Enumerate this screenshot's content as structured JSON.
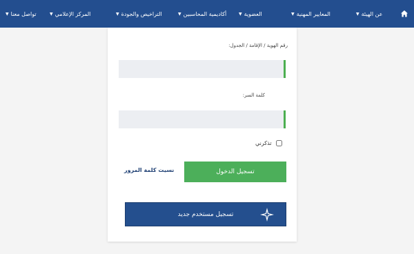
{
  "nav": {
    "items": [
      {
        "label": "عن الهيئة"
      },
      {
        "label": "المعايير المهنية"
      },
      {
        "label": "العضوية"
      },
      {
        "label": "أكاديمية المحاسبين"
      },
      {
        "label": "التراخيص والجودة"
      },
      {
        "label": "المركز الإعلامي"
      },
      {
        "label": "تواصل معنا"
      }
    ],
    "home_icon": "home-icon",
    "caret_icon": "chevron-down-icon"
  },
  "form": {
    "id_label": "رقم الهوية / الإقامة / الجدول:",
    "id_value": "",
    "password_label": "كلمة السر:",
    "password_value": "",
    "remember_label": "تذكرني",
    "login_label": "تسجيل الدخول",
    "forgot_label": "نسيت كلمة المرور",
    "register_label": "تسجيل مستخدم جديد",
    "register_icon": "sparkle-icon"
  },
  "colors": {
    "nav_bg": "#234e8f",
    "login_green": "#4caf5a",
    "register_blue": "#244f8e",
    "input_accent": "#4caf50"
  }
}
